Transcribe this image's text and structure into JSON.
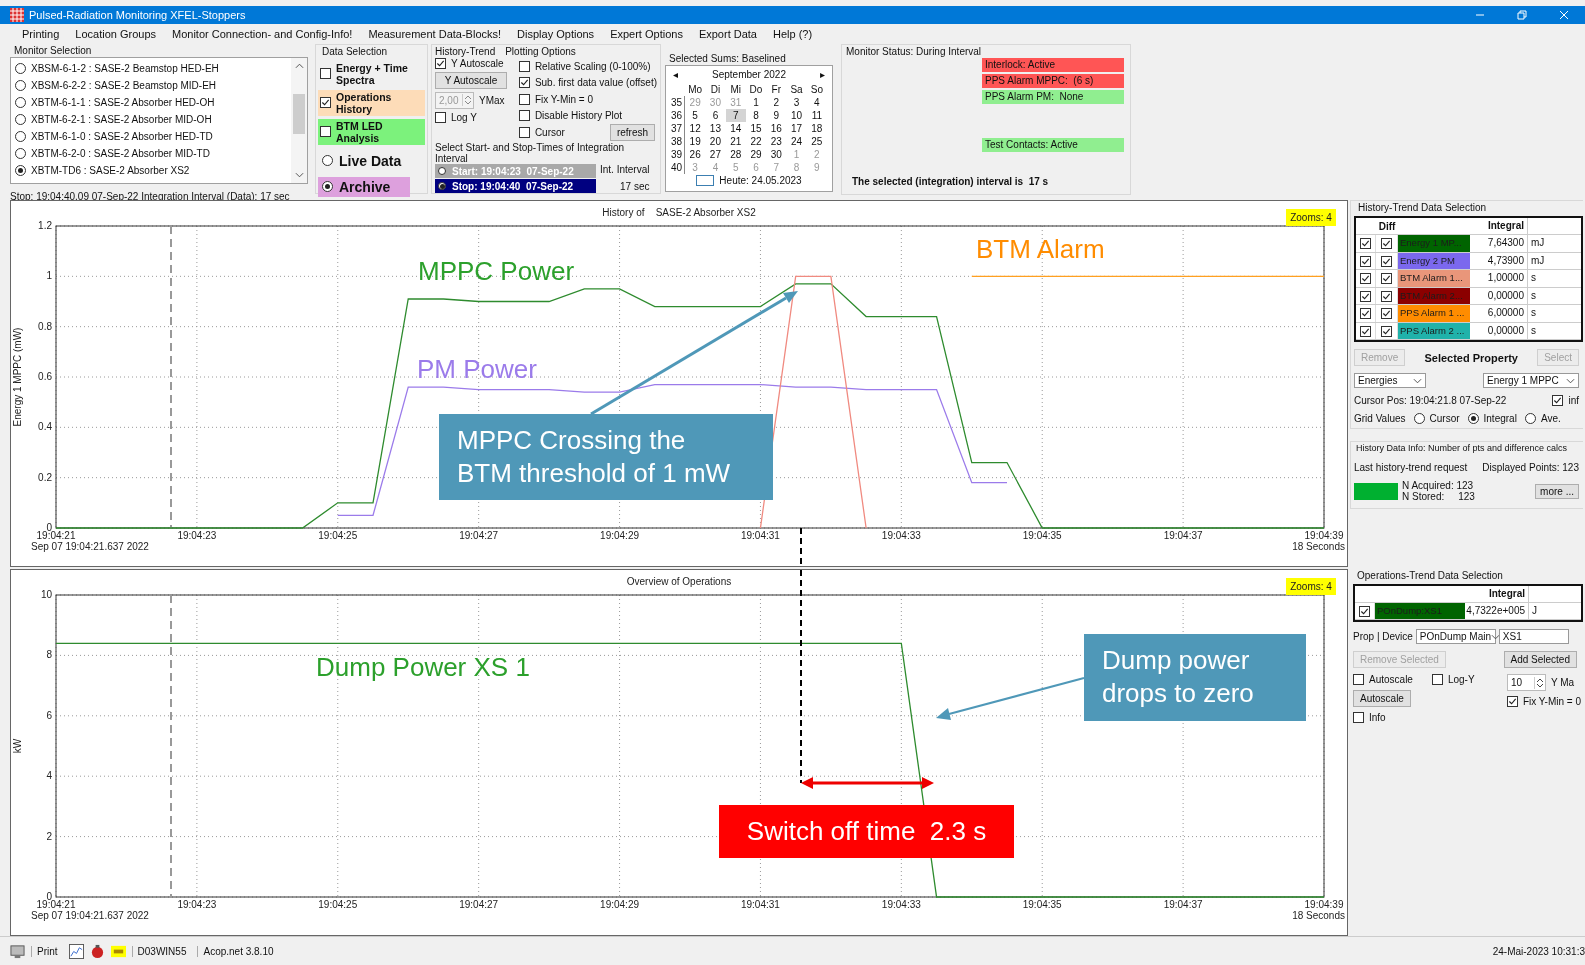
{
  "window": {
    "title": "Pulsed-Radiation Monitoring  XFEL-Stoppers"
  },
  "menu": [
    "Printing",
    "Location Groups",
    "Monitor Connection- and Config-Info!",
    "Measurement Data-Blocks!",
    "Display Options",
    "Expert Options",
    "Export Data",
    "Help (?)"
  ],
  "monitor_selection": {
    "title": "Monitor Selection",
    "items": [
      {
        "label": "XBSM-6-1-2 : SASE-2 Beamstop HED-EH",
        "selected": false
      },
      {
        "label": "XBSM-6-2-2 : SASE-2 Beamstop MID-EH",
        "selected": false
      },
      {
        "label": "XBTM-6-1-1 : SASE-2 Absorber HED-OH",
        "selected": false
      },
      {
        "label": "XBTM-6-2-1 : SASE-2 Absorber MID-OH",
        "selected": false
      },
      {
        "label": "XBTM-6-1-0 : SASE-2 Absorber HED-TD",
        "selected": false
      },
      {
        "label": "XBTM-6-2-0 : SASE-2 Absorber MID-TD",
        "selected": false
      },
      {
        "label": "XBTM-TD6 : SASE-2 Absorber XS2",
        "selected": true
      }
    ],
    "status": "Stop: 19:04:40.09  07-Sep-22    Integration Interval (Data): 17 sec"
  },
  "data_selection": {
    "title": "Data Selection",
    "options": [
      {
        "label": "Energy + Time Spectra",
        "checked": false
      },
      {
        "label": "Operations History",
        "checked": true,
        "color": "#fddcb8"
      },
      {
        "label": "BTM LED Analysis",
        "checked": false,
        "color": "#7cf27c"
      }
    ],
    "sources": [
      {
        "label": "Live Data",
        "selected": false
      },
      {
        "label": "Archive",
        "selected": true
      }
    ]
  },
  "history_trend": {
    "title": "History-Trend",
    "subtitle": "Plotting Options",
    "y_autoscale": {
      "label": "Y Autoscale",
      "checked": true
    },
    "autoscale_button": "Y Autoscale",
    "ymax": {
      "value": "2,00",
      "label": "YMax",
      "disabled": true
    },
    "log_y": {
      "label": "Log Y",
      "checked": false
    },
    "options": [
      {
        "label": "Relative Scaling (0-100%)",
        "checked": false
      },
      {
        "label": "Sub. first data value (offset)",
        "checked": true
      },
      {
        "label": "Fix Y-Min = 0",
        "checked": false
      },
      {
        "label": "Disable  History Plot",
        "checked": false
      },
      {
        "label": "Cursor",
        "checked": false
      }
    ],
    "refresh": "refresh"
  },
  "interval": {
    "title": "Select Start- and Stop-Times of Integration Interval",
    "times": [
      {
        "label": "Start: 19:04:23  07-Sep-22",
        "selected": false
      },
      {
        "label": "Stop: 19:04:40  07-Sep-22",
        "selected": true
      }
    ],
    "int_label": "Int. Interval",
    "int_value": "17 sec"
  },
  "calendar": {
    "title": "Selected Sums: Baselined",
    "month": "September 2022",
    "prev": "◂",
    "next": "▸",
    "weekdays": [
      "Mo",
      "Di",
      "Mi",
      "Do",
      "Fr",
      "Sa",
      "So"
    ],
    "weeks": [
      {
        "number": "35",
        "days": [
          {
            "day": "29",
            "other_month": true,
            "selected": false
          },
          {
            "day": "30",
            "other_month": true,
            "selected": false
          },
          {
            "day": "31",
            "other_month": true,
            "selected": false
          },
          {
            "day": "1",
            "other_month": false,
            "selected": false
          },
          {
            "day": "2",
            "other_month": false,
            "selected": false
          },
          {
            "day": "3",
            "other_month": false,
            "selected": false
          },
          {
            "day": "4",
            "other_month": false,
            "selected": false
          }
        ]
      },
      {
        "number": "36",
        "days": [
          {
            "day": "5",
            "other_month": false,
            "selected": false
          },
          {
            "day": "6",
            "other_month": false,
            "selected": false
          },
          {
            "day": "7",
            "other_month": false,
            "selected": true
          },
          {
            "day": "8",
            "other_month": false,
            "selected": false
          },
          {
            "day": "9",
            "other_month": false,
            "selected": false
          },
          {
            "day": "10",
            "other_month": false,
            "selected": false
          },
          {
            "day": "11",
            "other_month": false,
            "selected": false
          }
        ]
      },
      {
        "number": "37",
        "days": [
          {
            "day": "12",
            "other_month": false,
            "selected": false
          },
          {
            "day": "13",
            "other_month": false,
            "selected": false
          },
          {
            "day": "14",
            "other_month": false,
            "selected": false
          },
          {
            "day": "15",
            "other_month": false,
            "selected": false
          },
          {
            "day": "16",
            "other_month": false,
            "selected": false
          },
          {
            "day": "17",
            "other_month": false,
            "selected": false
          },
          {
            "day": "18",
            "other_month": false,
            "selected": false
          }
        ]
      },
      {
        "number": "38",
        "days": [
          {
            "day": "19",
            "other_month": false,
            "selected": false
          },
          {
            "day": "20",
            "other_month": false,
            "selected": false
          },
          {
            "day": "21",
            "other_month": false,
            "selected": false
          },
          {
            "day": "22",
            "other_month": false,
            "selected": false
          },
          {
            "day": "23",
            "other_month": false,
            "selected": false
          },
          {
            "day": "24",
            "other_month": false,
            "selected": false
          },
          {
            "day": "25",
            "other_month": false,
            "selected": false
          }
        ]
      },
      {
        "number": "39",
        "days": [
          {
            "day": "26",
            "other_month": false,
            "selected": false
          },
          {
            "day": "27",
            "other_month": false,
            "selected": false
          },
          {
            "day": "28",
            "other_month": false,
            "selected": false
          },
          {
            "day": "29",
            "other_month": false,
            "selected": false
          },
          {
            "day": "30",
            "other_month": false,
            "selected": false
          },
          {
            "day": "1",
            "other_month": true,
            "selected": false
          },
          {
            "day": "2",
            "other_month": true,
            "selected": false
          }
        ]
      },
      {
        "number": "40",
        "days": [
          {
            "day": "3",
            "other_month": true,
            "selected": false
          },
          {
            "day": "4",
            "other_month": true,
            "selected": false
          },
          {
            "day": "5",
            "other_month": true,
            "selected": false
          },
          {
            "day": "6",
            "other_month": true,
            "selected": false
          },
          {
            "day": "7",
            "other_month": true,
            "selected": false
          },
          {
            "day": "8",
            "other_month": true,
            "selected": false
          },
          {
            "day": "9",
            "other_month": true,
            "selected": false
          }
        ]
      }
    ],
    "today": "Heute: 24.05.2023"
  },
  "monitor_status": {
    "title": "Monitor Status: During Interval",
    "items": [
      {
        "label": "Interlock: Active",
        "color": "#ff5555"
      },
      {
        "label": "PPS Alarm MPPC:  (6 s)",
        "color": "#ff5555"
      },
      {
        "label": "PPS Alarm PM:  None",
        "color": "#90ee90"
      },
      {
        "label": "Test Contacts: Active",
        "color": "#90ee90"
      }
    ],
    "summary": "The selected (integration) interval is  17 s"
  },
  "history_chart": {
    "title": "History of    SASE-2 Absorber XS2",
    "zooms": "Zooms: 4",
    "start_label": "Sep 07 19:04:21.637 2022",
    "end_label": "18 Seconds",
    "labels": [
      {
        "text": "MPPC Power",
        "color": "#2ca02c"
      },
      {
        "text": "PM Power",
        "color": "#9b7bea"
      },
      {
        "text": "BTM Alarm",
        "color": "#ff8c00"
      }
    ],
    "callout": "MPPC Crossing the\nBTM threshold of 1 mW",
    "chart_data": {
      "type": "line",
      "ylabel": "Energy 1 MPPC (mW)",
      "ylim": [
        0,
        1.2
      ],
      "grid": true,
      "categories": [
        "19:04:21",
        null,
        null,
        null,
        "19:04:23",
        null,
        null,
        null,
        "19:04:25",
        null,
        null,
        null,
        "19:04:27",
        null,
        null,
        null,
        "19:04:29",
        null,
        null,
        null,
        "19:04:31",
        null,
        null,
        null,
        "19:04:33",
        null,
        null,
        null,
        "19:04:35",
        null,
        null,
        null,
        "19:04:37",
        null,
        null,
        null,
        "19:04:39"
      ],
      "yticks": [
        0,
        0.2,
        0.4,
        0.6,
        0.8,
        1,
        1.2
      ],
      "series": [
        {
          "color": "#9b7bea",
          "values": [
            null,
            null,
            null,
            null,
            null,
            null,
            null,
            null,
            0.05,
            0.05,
            0.56,
            0.56,
            0.55,
            0.55,
            0.55,
            0.54,
            0.54,
            0.57,
            0.57,
            0.57,
            0.57,
            0.56,
            0.56,
            0.55,
            0.55,
            0.55,
            0.18,
            0.18,
            null,
            null,
            null,
            null,
            null,
            null,
            null,
            null,
            null
          ]
        },
        {
          "color": "#ffa020",
          "values": [
            null,
            null,
            null,
            null,
            null,
            null,
            null,
            null,
            null,
            null,
            null,
            null,
            null,
            null,
            null,
            null,
            null,
            null,
            null,
            null,
            null,
            null,
            null,
            null,
            null,
            null,
            1,
            1,
            1,
            1,
            1,
            1,
            1,
            1,
            1,
            1,
            1
          ]
        },
        {
          "color": "#2e8b2e",
          "values": [
            0,
            0,
            0,
            0,
            0,
            0,
            0,
            0,
            0.1,
            0.1,
            0.91,
            0.91,
            0.9,
            0.9,
            0.9,
            0.95,
            0.95,
            0.88,
            0.88,
            0.88,
            0.88,
            0.97,
            0.97,
            0.84,
            0.84,
            0.84,
            0.26,
            0.26,
            0,
            0,
            0,
            0,
            0,
            0,
            0,
            0,
            0
          ]
        },
        {
          "color": "#f08a80",
          "values": [
            null,
            null,
            null,
            null,
            null,
            null,
            null,
            null,
            null,
            null,
            null,
            null,
            null,
            null,
            null,
            null,
            null,
            null,
            null,
            null,
            0,
            1,
            1,
            0,
            null,
            null,
            null,
            null,
            null,
            null,
            null,
            null,
            null,
            null,
            null,
            null,
            null
          ]
        }
      ]
    }
  },
  "operations_chart": {
    "title": "Overview of Operations",
    "zooms": "Zooms: 4",
    "start_label": "Sep 07 19:04:21.637 2022",
    "end_label": "18 Seconds",
    "labels": [
      {
        "text": "Dump Power XS 1",
        "color": "#2ca02c"
      }
    ],
    "callout": "Dump power\ndrops to zero",
    "highlight": "Switch off time  2.3 s",
    "chart_data": {
      "type": "line",
      "ylabel": "kW",
      "ylim": [
        0,
        10
      ],
      "grid": true,
      "categories": [
        "19:04:21",
        null,
        null,
        null,
        "19:04:23",
        null,
        null,
        null,
        "19:04:25",
        null,
        null,
        null,
        "19:04:27",
        null,
        null,
        null,
        "19:04:29",
        null,
        null,
        null,
        "19:04:31",
        null,
        null,
        null,
        "19:04:33",
        null,
        null,
        null,
        "19:04:35",
        null,
        null,
        null,
        "19:04:37",
        null,
        null,
        null,
        "19:04:39"
      ],
      "yticks": [
        0,
        2,
        4,
        6,
        8,
        10
      ],
      "series": [
        {
          "color": "#2e8b2e",
          "values": [
            8.4,
            8.4,
            8.4,
            8.4,
            8.4,
            8.4,
            8.4,
            8.4,
            8.4,
            8.4,
            8.4,
            8.4,
            8.4,
            8.4,
            8.4,
            8.4,
            8.4,
            8.4,
            8.4,
            8.4,
            8.4,
            8.4,
            8.4,
            8.4,
            8.4,
            0,
            0,
            0,
            0,
            0,
            0,
            0,
            0,
            0,
            0,
            0,
            0
          ]
        }
      ]
    }
  },
  "history_selection": {
    "title": "History-Trend Data Selection",
    "columns": [
      "Diff",
      "Integral"
    ],
    "rows": [
      {
        "shown": true,
        "diff": true,
        "name": "Energy 1 MP...",
        "color": "#006400",
        "value": "7,64300",
        "unit": "mJ"
      },
      {
        "shown": true,
        "diff": true,
        "name": "Energy 2 PM",
        "color": "#7b68ee",
        "value": "4,73900",
        "unit": "mJ"
      },
      {
        "shown": true,
        "diff": true,
        "name": "BTM Alarm 1...",
        "color": "#e9967a",
        "value": "1,00000",
        "unit": "s"
      },
      {
        "shown": true,
        "diff": true,
        "name": "BTM Alarm 2...",
        "color": "#8b0000",
        "value": "0,00000",
        "unit": "s"
      },
      {
        "shown": true,
        "diff": true,
        "name": "PPS Alarm 1 ...",
        "color": "#ff8c00",
        "value": "6,00000",
        "unit": "s"
      },
      {
        "shown": true,
        "diff": true,
        "name": "PPS Alarm 2 ...",
        "color": "#20b2aa",
        "value": "0,00000",
        "unit": "s"
      }
    ],
    "remove": {
      "label": "Remove",
      "disabled": true
    },
    "selected_property": "Selected Property",
    "select": {
      "label": "Select",
      "disabled": true
    },
    "dropdowns": [
      "Energies",
      "Energy 1 MPPC"
    ],
    "cursor_pos": "Cursor Pos: 19:04:21.8  07-Sep-22",
    "info": {
      "label": "inf",
      "checked": true
    },
    "grid_values": {
      "label": "Grid Values",
      "options": [
        {
          "label": "Cursor",
          "selected": false
        },
        {
          "label": "Integral",
          "selected": true
        },
        {
          "label": "Ave.",
          "selected": false
        }
      ]
    }
  },
  "history_info": {
    "title": "History Data Info: Number of pts and difference calcs",
    "last_request": "Last history-trend request",
    "displayed": "Displayed Points: 123",
    "acquired": "N Acquired: 123",
    "stored": "N Stored:     123",
    "more": "more ..."
  },
  "operations_selection": {
    "title": "Operations-Trend Data Selection",
    "columns": [
      "Integral"
    ],
    "rows": [
      {
        "shown": true,
        "name": "POnDump:XS1",
        "color": "#006400",
        "value": "4,7322e+005",
        "unit": "J"
      }
    ],
    "prop_label": "Prop | Device",
    "dropdowns": [
      "POnDump Main",
      "XS1"
    ],
    "remove": {
      "label": "Remove Selected",
      "disabled": true
    },
    "add": {
      "label": "Add Selected",
      "disabled": false
    },
    "autoscale": {
      "label": "Autoscale",
      "checked": false
    },
    "log_y": {
      "label": "Log-Y",
      "checked": false
    },
    "autoscale_button": "Autoscale",
    "ymax": {
      "value": "10",
      "label": "Y Ma"
    },
    "fix_ymin": {
      "label": "Fix Y-Min = 0",
      "checked": true
    },
    "info": {
      "label": "Info",
      "checked": false
    }
  },
  "status_bar": {
    "print": "Print",
    "host": "D03WIN55",
    "version": "Acop.net 3.8.10",
    "time": "24-Mai-2023 10:31:3"
  }
}
